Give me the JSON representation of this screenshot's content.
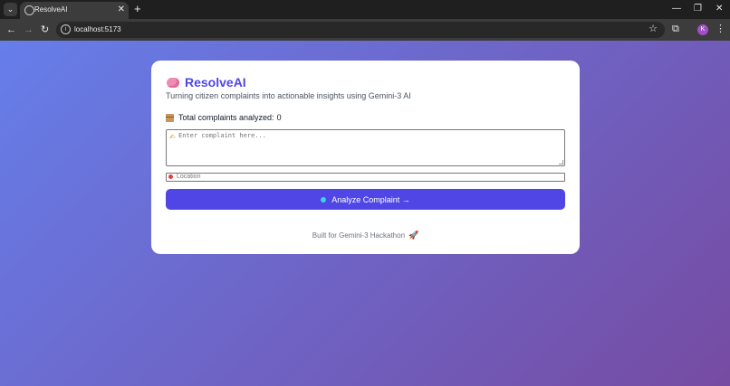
{
  "browser": {
    "tab_title": "ResolveAI",
    "tab_close": "✕",
    "new_tab": "+",
    "url": "localhost:5173",
    "avatar_letter": "K",
    "window_controls": [
      "—",
      "❐",
      "✕"
    ]
  },
  "app": {
    "title": "ResolveAI",
    "subtitle": "Turning citizen complaints into actionable insights using Gemini-3 AI",
    "count_label": "Total complaints analyzed:",
    "count_value": "0",
    "complaint_placeholder": "Enter complaint here...",
    "location_placeholder": "Location",
    "analyze_button": "Analyze Complaint →",
    "footer": "Built for Gemini-3 Hackathon",
    "accent_color": "#4f46e5",
    "gradient": [
      "#667eea",
      "#764ba2"
    ],
    "icons": {
      "title": "brain-icon",
      "count": "package-icon",
      "complaint": "writing-hand-icon",
      "location": "pin-icon",
      "button": "dot-icon",
      "footer": "rocket-icon"
    }
  }
}
